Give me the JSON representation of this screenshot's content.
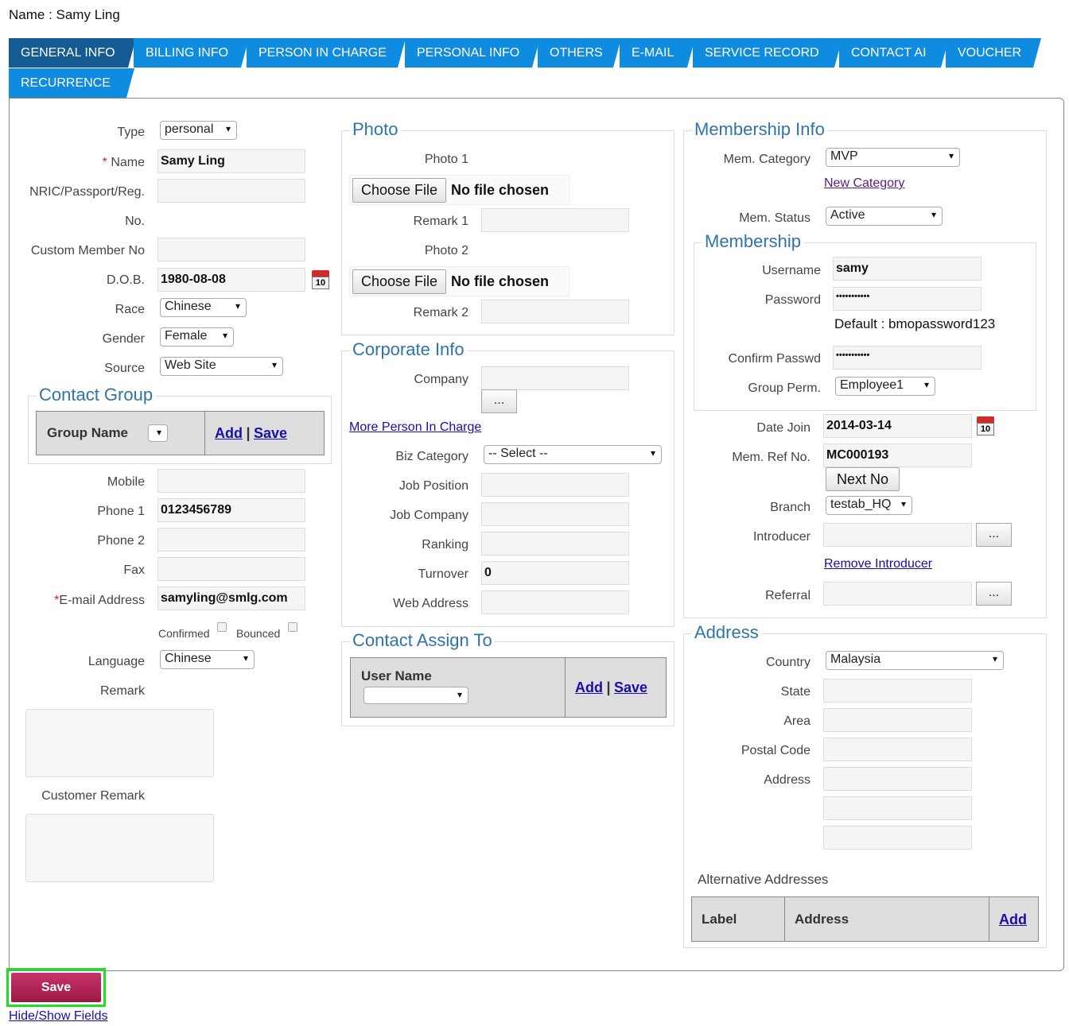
{
  "header": {
    "name_label": "Name : Samy Ling"
  },
  "tabs": [
    {
      "label": "GENERAL INFO"
    },
    {
      "label": "BILLING INFO"
    },
    {
      "label": "PERSON IN CHARGE"
    },
    {
      "label": "PERSONAL INFO"
    },
    {
      "label": "OTHERS"
    },
    {
      "label": "E-MAIL"
    },
    {
      "label": "SERVICE RECORD"
    },
    {
      "label": "CONTACT AI"
    },
    {
      "label": "VOUCHER"
    },
    {
      "label": "RECURRENCE"
    }
  ],
  "left": {
    "type_label": "Type",
    "type_value": "personal",
    "name_req": "*",
    "name_label": "Name",
    "name_value": "Samy Ling",
    "nric_label": "NRIC/Passport/Reg.",
    "nric_label2": "No.",
    "nric_value": "",
    "custom_member_label": "Custom Member No",
    "custom_member_value": "",
    "dob_label": "D.O.B.",
    "dob_value": "1980-08-08",
    "calendar_day": "10",
    "race_label": "Race",
    "race_value": "Chinese",
    "gender_label": "Gender",
    "gender_value": "Female",
    "source_label": "Source",
    "source_value": "Web Site",
    "contact_group_legend": "Contact Group",
    "group_name_header": "Group Name",
    "group_add": "Add",
    "group_sep": "|",
    "group_save": "Save",
    "mobile_label": "Mobile",
    "mobile_value": "",
    "phone1_label": "Phone 1",
    "phone1_value": "0123456789",
    "phone2_label": "Phone 2",
    "phone2_value": "",
    "fax_label": "Fax",
    "fax_value": "",
    "email_req": "*",
    "email_label": "E-mail Address",
    "email_value": "samyling@smlg.com",
    "confirmed_label": "Confirmed",
    "bounced_label": "Bounced",
    "language_label": "Language",
    "language_value": "Chinese",
    "remark_label": "Remark",
    "customer_remark_label": "Customer Remark"
  },
  "middle": {
    "photo_legend": "Photo",
    "photo1_label": "Photo 1",
    "choose_file": "Choose File",
    "no_file": "No file chosen",
    "remark1_label": "Remark 1",
    "photo2_label": "Photo 2",
    "remark2_label": "Remark 2",
    "corporate_legend": "Corporate Info",
    "company_label": "Company",
    "dots": "...",
    "more_pic_link": "More Person In Charge",
    "biz_category_label": "Biz Category",
    "biz_category_value": "-- Select --",
    "job_position_label": "Job Position",
    "job_company_label": "Job Company",
    "ranking_label": "Ranking",
    "turnover_label": "Turnover",
    "turnover_value": "0",
    "web_address_label": "Web Address",
    "assign_legend": "Contact Assign To",
    "user_name_header": "User Name",
    "assign_add": "Add",
    "assign_sep": "|",
    "assign_save": "Save"
  },
  "right": {
    "membership_info_legend": "Membership Info",
    "mem_category_label": "Mem. Category",
    "mem_category_value": "MVP",
    "new_category_link": "New Category",
    "mem_status_label": "Mem. Status",
    "mem_status_value": "Active",
    "membership_legend": "Membership",
    "username_label": "Username",
    "username_value": "samy",
    "password_label": "Password",
    "password_value": "•••••••••••",
    "default_pw_note": "Default : bmopassword123",
    "confirm_pw_label": "Confirm Passwd",
    "confirm_pw_value": "•••••••••••",
    "group_perm_label": "Group Perm.",
    "group_perm_value": "Employee1",
    "date_join_label": "Date Join",
    "date_join_value": "2014-03-14",
    "mem_ref_label": "Mem. Ref No.",
    "mem_ref_value": "MC000193",
    "next_no_button": "Next No",
    "branch_label": "Branch",
    "branch_value": "testab_HQ",
    "introducer_label": "Introducer",
    "remove_introducer_link": "Remove Introducer",
    "referral_label": "Referral",
    "address_legend": "Address",
    "country_label": "Country",
    "country_value": "Malaysia",
    "state_label": "State",
    "area_label": "Area",
    "postal_label": "Postal Code",
    "address_label": "Address",
    "alt_addresses_label": "Alternative Addresses",
    "alt_col_label": "Label",
    "alt_col_address": "Address",
    "alt_add": "Add"
  },
  "footer": {
    "save_button": "Save",
    "hide_show_link": "Hide/Show Fields"
  }
}
